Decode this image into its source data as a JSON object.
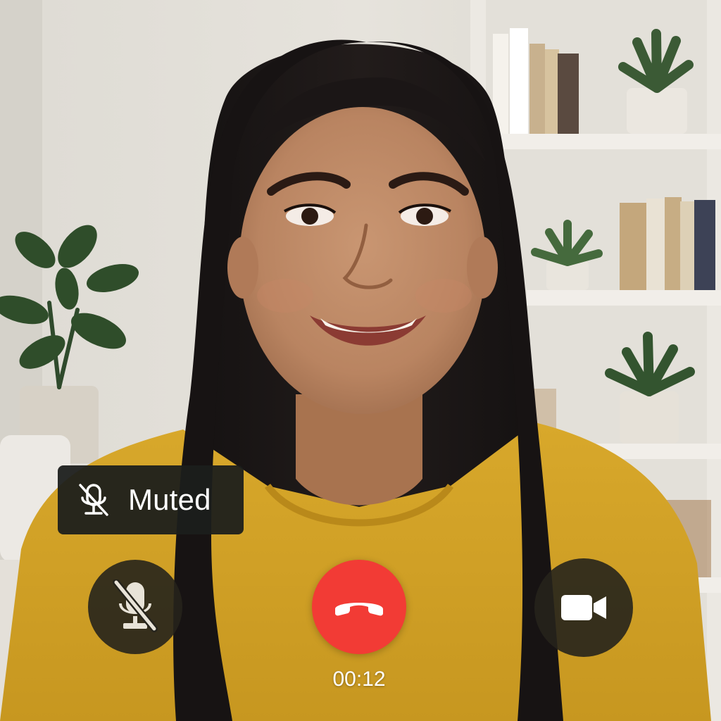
{
  "call": {
    "status_label": "Muted",
    "timer": "00:12",
    "microphone_muted": true,
    "camera_on": true
  },
  "controls": {
    "mute_icon": "mic-off-icon",
    "end_call_icon": "phone-hangup-icon",
    "camera_icon": "video-camera-icon"
  },
  "colors": {
    "end_call": "#f23b35",
    "control_background": "#26241c",
    "toast_background": "#1c1e1c",
    "text": "#ffffff"
  }
}
